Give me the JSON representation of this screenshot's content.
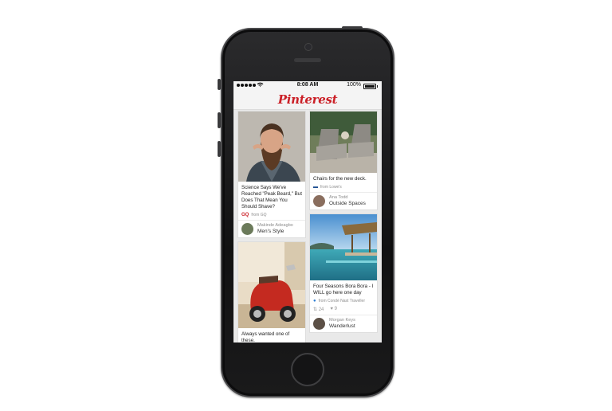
{
  "status": {
    "time": "8:08 AM",
    "battery": "100%"
  },
  "app": {
    "logo": "Pinterest"
  },
  "pins": [
    {
      "description": "Science Says We've Reached \"Peak Beard,\" But Does That Mean You Should Shave?",
      "source": "from GQ",
      "user": "Makinde Adeagbo",
      "board": "Men's Style"
    },
    {
      "description": "Always wanted one of these."
    },
    {
      "description": "Chairs for the new deck.",
      "source": "from Lowe's",
      "user": "Ana Todd",
      "board": "Outside Spaces"
    },
    {
      "description": "Four Seasons Bora Bora - I WILL go here one day",
      "source": "from Condé Nast Traveller",
      "repins": "24",
      "likes": "9",
      "user": "Morgan Keys",
      "board": "Wanderlust"
    }
  ],
  "colors": {
    "brand": "#cb2027",
    "phone_body": "#1a1a1b"
  },
  "icons": [
    "signal-icon",
    "wifi-icon",
    "battery-icon",
    "repin-icon",
    "heart-icon",
    "gq-source-icon",
    "lowes-source-icon",
    "location-pin-icon"
  ]
}
